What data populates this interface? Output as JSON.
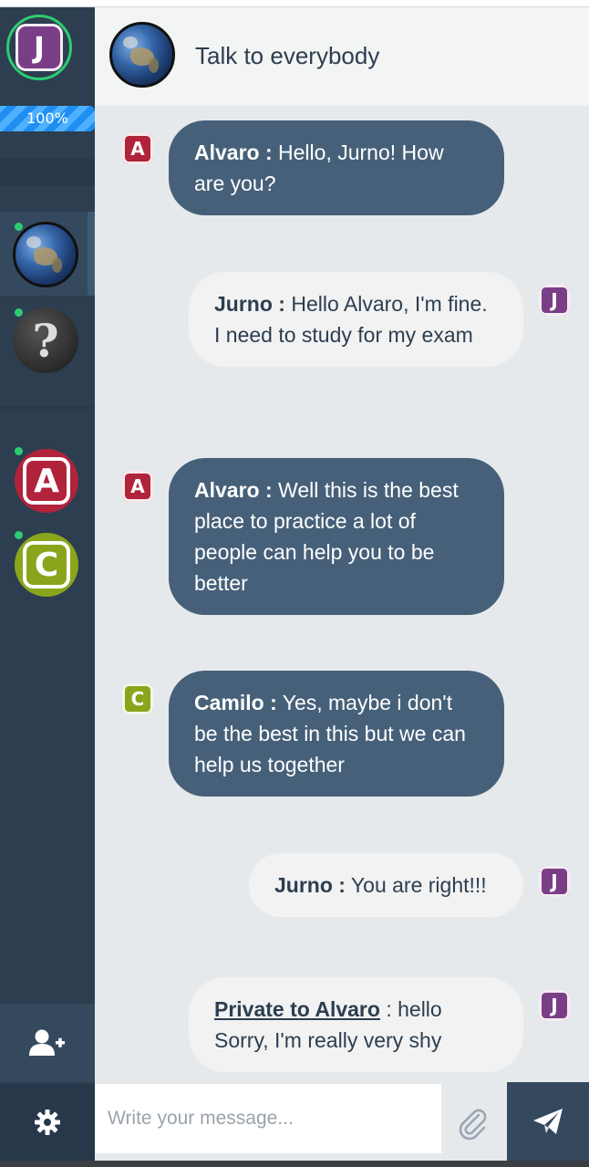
{
  "header": {
    "title": "Talk to everybody"
  },
  "profile": {
    "progress": "100%"
  },
  "messages": [
    {
      "sender": "Alvaro :",
      "text": " Hello, Jurno! How are you?",
      "direction": "in",
      "avatar": "A"
    },
    {
      "sender": "Jurno :",
      "text": " Hello Alvaro, I'm fine. I need to study for my exam",
      "direction": "out",
      "avatar": "J"
    },
    {
      "sender": "Alvaro :",
      "text": " Well this is the best place to practice a lot of people can help you to be better",
      "direction": "in",
      "avatar": "A"
    },
    {
      "sender": "Camilo :",
      "text": " Yes, maybe i don't be the best in this but we can help us together",
      "direction": "in",
      "avatar": "C"
    },
    {
      "sender": "Jurno :",
      "text": " You are right!!!",
      "direction": "out",
      "avatar": "J"
    },
    {
      "private_label": "Private to Alvaro",
      "text": " : hello Sorry, I'm really very shy",
      "direction": "out",
      "avatar": "J"
    }
  ],
  "avatars": {
    "me": "J",
    "alvaro": "A",
    "camilo": "C",
    "unknown": "?"
  },
  "composer": {
    "placeholder": "Write your message..."
  },
  "icons": {
    "add_user": "add-user-icon",
    "settings": "gear-icon",
    "attach": "paperclip-icon",
    "send": "paper-plane-icon"
  },
  "colors": {
    "sidebar": "#2c3e50",
    "incoming_bubble": "#466079",
    "outgoing_bubble": "#f2f2f2",
    "online": "#2ecc71"
  }
}
